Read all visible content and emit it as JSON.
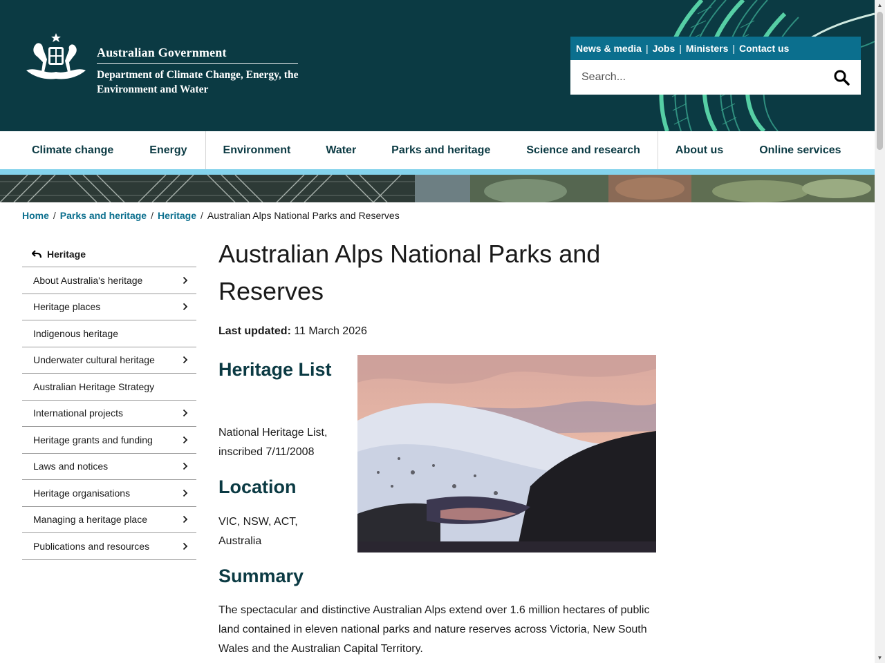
{
  "header": {
    "gov_title": "Australian Government",
    "department": "Department of Climate Change, Energy, the Environment and Water",
    "utility_links": [
      "News & media",
      "Jobs",
      "Ministers",
      "Contact us"
    ],
    "search_placeholder": "Search..."
  },
  "nav": {
    "items": [
      "Climate change",
      "Energy",
      "Environment",
      "Water",
      "Parks and heritage",
      "Science and research",
      "About us",
      "Online services"
    ]
  },
  "breadcrumb": {
    "links": [
      "Home",
      "Parks and heritage",
      "Heritage"
    ],
    "current": "Australian Alps National Parks and Reserves",
    "separator": "/"
  },
  "sidebar": {
    "back_label": "Heritage",
    "items": [
      {
        "label": "About Australia's heritage",
        "has_children": true
      },
      {
        "label": "Heritage places",
        "has_children": true
      },
      {
        "label": "Indigenous heritage",
        "has_children": false
      },
      {
        "label": "Underwater cultural heritage",
        "has_children": true
      },
      {
        "label": "Australian Heritage Strategy",
        "has_children": false
      },
      {
        "label": "International projects",
        "has_children": true
      },
      {
        "label": "Heritage grants and funding",
        "has_children": true
      },
      {
        "label": "Laws and notices",
        "has_children": true
      },
      {
        "label": "Heritage organisations",
        "has_children": true
      },
      {
        "label": "Managing a heritage place",
        "has_children": true
      },
      {
        "label": "Publications and resources",
        "has_children": true
      }
    ]
  },
  "content": {
    "title": "Australian Alps National Parks and Reserves",
    "updated_label": "Last updated:",
    "updated_value": "11 March 2026",
    "heritage_list_heading": "Heritage List",
    "heritage_list_text": "National Heritage List, inscribed 7/11/2008",
    "location_heading": "Location",
    "location_text": "VIC, NSW, ACT, Australia",
    "summary_heading": "Summary",
    "summary_text": "The spectacular and distinctive Australian Alps extend over 1.6 million hectares of public land contained in eleven national parks and nature reserves across Victoria, New South Wales and the Australian Capital Territory."
  },
  "colors": {
    "header_bg": "#0b3a43",
    "utility_bar": "#0b6f8e",
    "nav_text": "#0b3a43",
    "nav_underline": "#84d3ec",
    "link": "#0b6f8e",
    "heading": "#0b3a43"
  },
  "icons": {
    "crest": "coat-of-arms-icon",
    "search": "search-icon",
    "back": "back-arrow-icon",
    "chevron": "chevron-right-icon"
  }
}
